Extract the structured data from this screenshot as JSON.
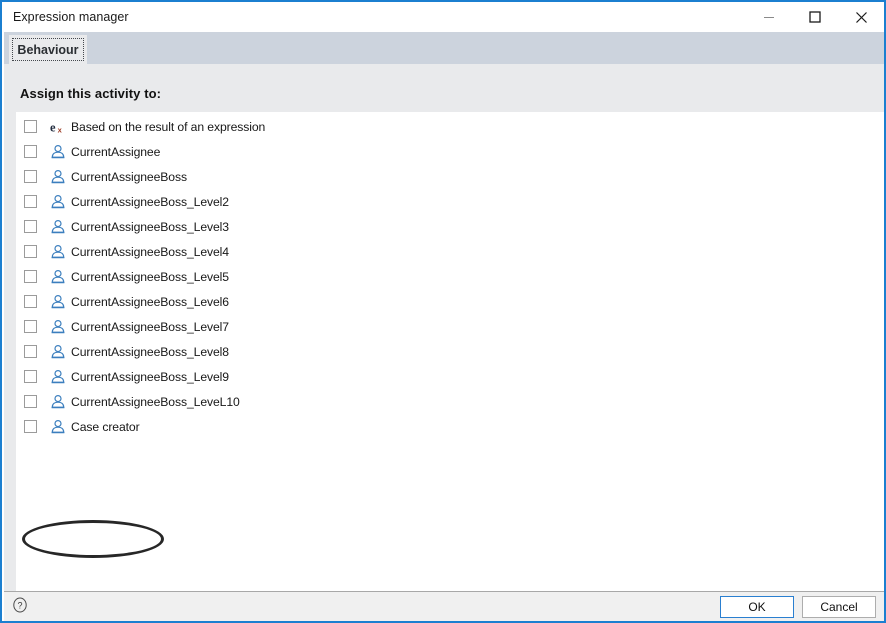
{
  "window": {
    "title": "Expression manager",
    "controls": [
      {
        "name": "minimize",
        "glyph": "minimize-icon",
        "label": "Minimize"
      },
      {
        "name": "maximize",
        "glyph": "maximize-icon",
        "label": "Maximize"
      },
      {
        "name": "close",
        "glyph": "close-icon",
        "label": "Close"
      }
    ],
    "border_color": "#1b7fd0"
  },
  "tabs": [
    {
      "label": "Behaviour",
      "active": true
    }
  ],
  "main": {
    "section_title": "Assign this activity to:",
    "items": [
      {
        "label": "Based on the result of an expression",
        "icon": "expression-icon",
        "checked": false
      },
      {
        "label": "CurrentAssignee",
        "icon": "person-icon",
        "checked": false
      },
      {
        "label": "CurrentAssigneeBoss",
        "icon": "person-icon",
        "checked": false
      },
      {
        "label": "CurrentAssigneeBoss_Level2",
        "icon": "person-icon",
        "checked": false
      },
      {
        "label": "CurrentAssigneeBoss_Level3",
        "icon": "person-icon",
        "checked": false
      },
      {
        "label": "CurrentAssigneeBoss_Level4",
        "icon": "person-icon",
        "checked": false
      },
      {
        "label": "CurrentAssigneeBoss_Level5",
        "icon": "person-icon",
        "checked": false
      },
      {
        "label": "CurrentAssigneeBoss_Level6",
        "icon": "person-icon",
        "checked": false
      },
      {
        "label": "CurrentAssigneeBoss_Level7",
        "icon": "person-icon",
        "checked": false
      },
      {
        "label": "CurrentAssigneeBoss_Level8",
        "icon": "person-icon",
        "checked": false
      },
      {
        "label": "CurrentAssigneeBoss_Level9",
        "icon": "person-icon",
        "checked": false
      },
      {
        "label": "CurrentAssigneeBoss_LeveL10",
        "icon": "person-icon",
        "checked": false
      },
      {
        "label": "Case creator",
        "icon": "person-icon",
        "checked": false
      }
    ],
    "annotation": {
      "target_label": "Case creator",
      "shape": "ellipse",
      "color": "#272727"
    }
  },
  "footer": {
    "help_icon": "help-circle-icon",
    "ok_label": "OK",
    "cancel_label": "Cancel"
  },
  "colors": {
    "accent": "#1b7fd0",
    "tabstrip": "#ccd3dd",
    "panel": "#e9eaec",
    "list_background": "#ffffff",
    "person_icon": "#3c7fbe",
    "expression_e": "#1f2a3d",
    "expression_x": "#9b3a22"
  }
}
